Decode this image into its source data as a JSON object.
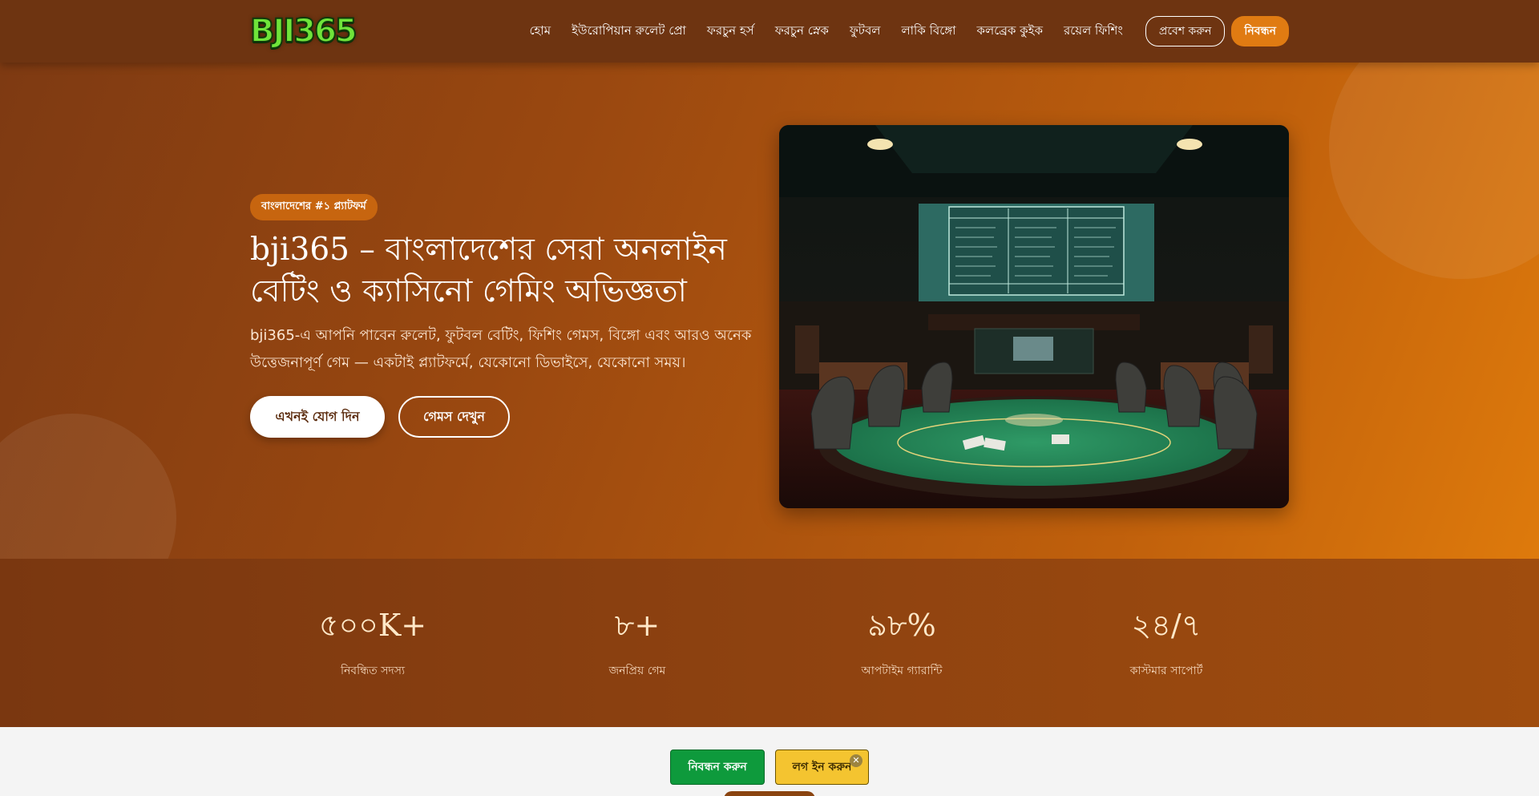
{
  "header": {
    "logo_text": "BJI365",
    "nav": [
      "হোম",
      "ইউরোপিয়ান রুলেট প্রো",
      "ফরচুন হর্স",
      "ফরচুন স্নেক",
      "ফুটবল",
      "লাকি বিঙ্গো",
      "কলব্রেক কুইক",
      "রয়েল ফিশিং"
    ],
    "login_label": "প্রবেশ করুন",
    "register_label": "নিবন্ধন"
  },
  "hero": {
    "badge": "বাংলাদেশের #১ প্ল্যাটফর্ম",
    "title": "bji365 – বাংলাদেশের সেরা অনলাইন বেটিং ও ক্যাসিনো গেমিং অভিজ্ঞতা",
    "description": "bji365-এ আপনি পাবেন রুলেট, ফুটবল বেটিং, ফিশিং গেমস, বিঙ্গো এবং আরও অনেক উত্তেজনাপূর্ণ গেম — একটাই প্ল্যাটফর্মে, যেকোনো ডিভাইসে, যেকোনো সময়।",
    "join_label": "এখনই যোগ দিন",
    "games_label": "গেমস দেখুন"
  },
  "stats": [
    {
      "value": "৫০০K+",
      "label": "নিবন্ধিত সদস্য"
    },
    {
      "value": "৮+",
      "label": "জনপ্রিয় গেম"
    },
    {
      "value": "৯৮%",
      "label": "আপটাইম গ্যারান্টি"
    },
    {
      "value": "২৪/৭",
      "label": "কাস্টমার সাপোর্ট"
    }
  ],
  "bottom_bar": {
    "register_label": "নিবন্ধন করুন",
    "login_label": "লগ ইন করুন",
    "close_glyph": "✕"
  },
  "colors": {
    "header_bg": "#6e3411",
    "accent": "#e07b12",
    "cta_green": "#0e9a3c",
    "cta_yellow": "#f4c430"
  }
}
